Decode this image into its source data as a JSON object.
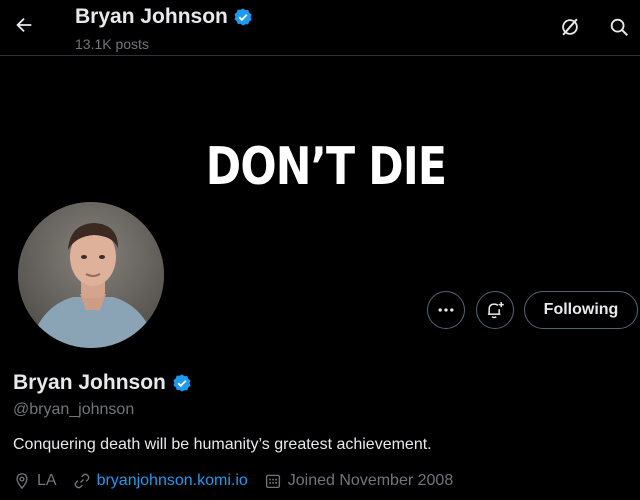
{
  "header": {
    "name": "Bryan Johnson",
    "post_count": "13.1K posts"
  },
  "banner": {
    "text": "DON’T DIE"
  },
  "actions": {
    "follow_label": "Following"
  },
  "profile": {
    "display_name": "Bryan Johnson",
    "handle": "@bryan_johnson",
    "bio": "Conquering death will be humanity’s greatest achievement.",
    "location": "LA",
    "website": "bryanjohnson.komi.io",
    "joined": "Joined November 2008"
  },
  "icons": {
    "back": "arrow-left-icon",
    "grok": "grok-icon",
    "search": "search-icon",
    "verified": "verified-badge-icon",
    "more": "more-dots-icon",
    "notify": "bell-plus-icon",
    "location": "location-pin-icon",
    "link": "link-icon",
    "calendar": "calendar-icon"
  },
  "colors": {
    "background": "#000000",
    "text": "#e7e9ea",
    "muted": "#71767b",
    "accent": "#1d9bf0",
    "border": "#536471"
  }
}
